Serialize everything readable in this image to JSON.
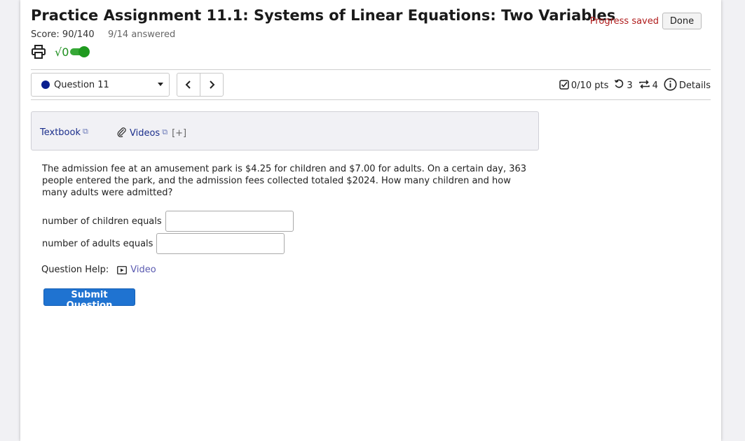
{
  "header": {
    "title": "Practice Assignment 11.1: Systems of Linear Equations: Two Variables",
    "score": "Score: 90/140",
    "answered": "9/14 answered",
    "sqrt_symbol": "√0",
    "progress_status": "Progress saved",
    "done_label": "Done"
  },
  "nav": {
    "question_label": "Question 11",
    "prev_glyph": "‹",
    "next_glyph": "›",
    "points": "0/10 pts",
    "retries": "3",
    "attempts": "4",
    "details_label": "Details"
  },
  "resources": {
    "textbook_label": "Textbook",
    "videos_label": "Videos",
    "expand_label": "[+]"
  },
  "question": {
    "text": "The admission fee at an amusement park is $4.25 for children and $7.00 for adults. On a certain day, 363 people entered the park, and the admission fees collected totaled $2024. How many children and how many adults were admitted?",
    "children_label": "number of children equals",
    "children_value": "",
    "adults_label": "number of adults equals",
    "adults_value": ""
  },
  "help": {
    "label": "Question Help:",
    "video_label": "Video"
  },
  "submit_label": "Submit Question",
  "colors": {
    "accent_blue": "#1f73d1",
    "saved_red": "#b01c1c",
    "toggle_green": "#1f9a1f"
  }
}
